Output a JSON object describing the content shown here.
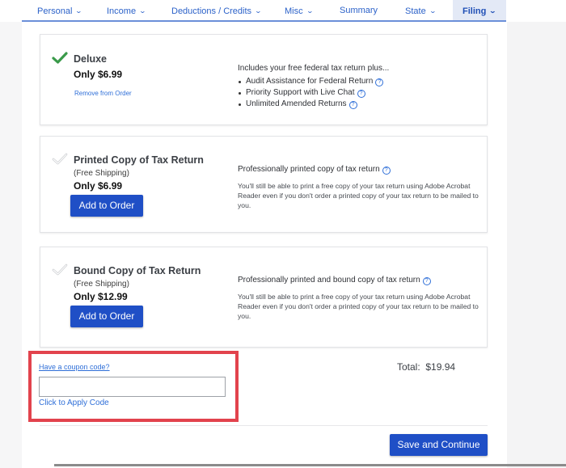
{
  "nav": {
    "items": [
      {
        "label": "Personal",
        "has_dropdown": true,
        "active": false
      },
      {
        "label": "Income",
        "has_dropdown": true,
        "active": false
      },
      {
        "label": "Deductions / Credits",
        "has_dropdown": true,
        "active": false
      },
      {
        "label": "Misc",
        "has_dropdown": true,
        "active": false
      },
      {
        "label": "Summary",
        "has_dropdown": false,
        "active": false
      },
      {
        "label": "State",
        "has_dropdown": true,
        "active": false
      },
      {
        "label": "Filing",
        "has_dropdown": true,
        "active": true
      }
    ],
    "chevron": "⌄"
  },
  "products": [
    {
      "name": "Deluxe",
      "selected": true,
      "price": "Only $6.99",
      "action_label": "Remove from Order",
      "description_title": "Includes your free federal tax return plus...",
      "benefits": [
        "Audit Assistance for Federal Return",
        "Priority Support with Live Chat",
        "Unlimited Amended Returns"
      ]
    },
    {
      "name": "Printed Copy of Tax Return",
      "selected": false,
      "shipping": "(Free Shipping)",
      "price": "Only $6.99",
      "action_label": "Add to Order",
      "description_title": "Professionally printed copy of tax return",
      "description_body": "You'll still be able to print a free copy of your tax return using Adobe Acrobat Reader even if you don't order a printed copy of your tax return to be mailed to you."
    },
    {
      "name": "Bound Copy of Tax Return",
      "selected": false,
      "shipping": "(Free Shipping)",
      "price": "Only $12.99",
      "action_label": "Add to Order",
      "description_title": "Professionally printed and bound copy of tax return",
      "description_body": "You'll still be able to print a free copy of your tax return using Adobe Acrobat Reader even if you don't order a printed copy of your tax return to be mailed to you."
    }
  ],
  "help_glyph": "?",
  "coupon": {
    "link_label": "Have a coupon code?",
    "input_value": "",
    "input_placeholder": "",
    "apply_label": "Click to Apply Code"
  },
  "total": {
    "label": "Total:",
    "value": "$19.94"
  },
  "footer": {
    "save_label": "Save and Continue"
  },
  "colors": {
    "accent": "#1f4fc6",
    "link": "#2f6fd8",
    "check": "#3a9a4a",
    "highlight_box": "#e2434d"
  }
}
